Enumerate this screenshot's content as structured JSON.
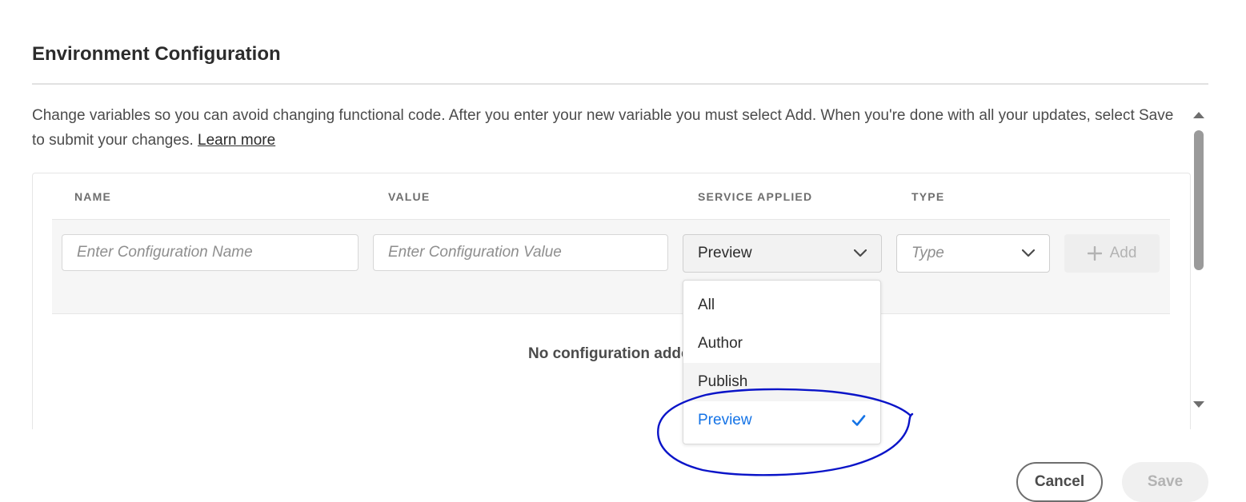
{
  "dialog": {
    "title": "Environment Configuration",
    "description": "Change variables so you can avoid changing functional code. After you enter your new variable you must select Add. When you're done with all your updates, select Save to submit your changes.",
    "learn_more": "Learn more"
  },
  "table": {
    "headers": {
      "name": "NAME",
      "value": "VALUE",
      "service": "SERVICE APPLIED",
      "type": "TYPE"
    },
    "new_row": {
      "name_placeholder": "Enter Configuration Name",
      "value_placeholder": "Enter Configuration Value",
      "service_selected": "Preview",
      "type_placeholder": "Type",
      "add_label": "Add"
    },
    "empty_message": "No configuration adde"
  },
  "service_dropdown": {
    "options": [
      "All",
      "Author",
      "Publish",
      "Preview"
    ],
    "hovered": "Publish",
    "selected": "Preview"
  },
  "footer": {
    "cancel_label": "Cancel",
    "save_label": "Save"
  },
  "colors": {
    "accent": "#1473e6",
    "annotation": "#0a14c8"
  }
}
